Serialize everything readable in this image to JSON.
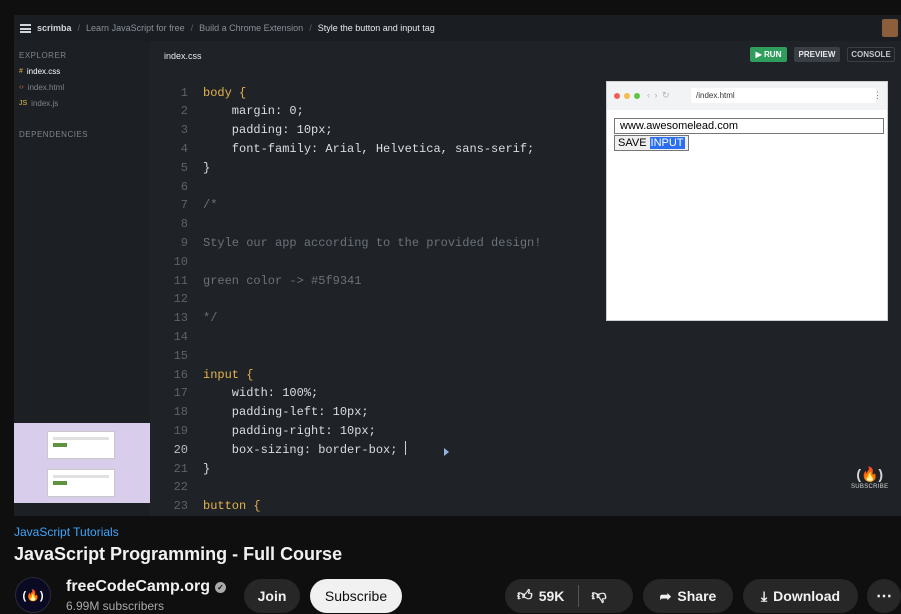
{
  "breadcrumb": {
    "brand": "scrimba",
    "items": [
      "Learn JavaScript for free",
      "Build a Chrome Extension"
    ],
    "active": "Style the button and input tag"
  },
  "sidebar": {
    "explorer_label": "EXPLORER",
    "files": [
      {
        "icon": "#",
        "name": "index.css",
        "active": true
      },
      {
        "icon": "‹›",
        "name": "index.html",
        "active": false
      },
      {
        "icon": "JS",
        "name": "index.js",
        "active": false
      }
    ],
    "dependencies_label": "DEPENDENCIES"
  },
  "editor": {
    "tab": "index.css",
    "run_label": "▶ RUN",
    "preview_label": "PREVIEW",
    "console_label": "CONSOLE",
    "lines": [
      {
        "n": "1",
        "text": "body {"
      },
      {
        "n": "2",
        "text": "    margin: 0;"
      },
      {
        "n": "3",
        "text": "    padding: 10px;"
      },
      {
        "n": "4",
        "text": "    font-family: Arial, Helvetica, sans-serif;"
      },
      {
        "n": "5",
        "text": "}"
      },
      {
        "n": "6",
        "text": ""
      },
      {
        "n": "7",
        "text": "/*"
      },
      {
        "n": "8",
        "text": ""
      },
      {
        "n": "9",
        "text": "Style our app according to the provided design!"
      },
      {
        "n": "10",
        "text": ""
      },
      {
        "n": "11",
        "text": "green color -> #5f9341"
      },
      {
        "n": "12",
        "text": ""
      },
      {
        "n": "13",
        "text": "*/"
      },
      {
        "n": "14",
        "text": ""
      },
      {
        "n": "15",
        "text": ""
      },
      {
        "n": "16",
        "text": "input {"
      },
      {
        "n": "17",
        "text": "    width: 100%;"
      },
      {
        "n": "18",
        "text": "    padding-left: 10px;"
      },
      {
        "n": "19",
        "text": "    padding-right: 10px;"
      },
      {
        "n": "20",
        "text": "    box-sizing: border-box;"
      },
      {
        "n": "21",
        "text": "}"
      },
      {
        "n": "22",
        "text": ""
      },
      {
        "n": "23",
        "text": "button {"
      }
    ]
  },
  "preview": {
    "url": "/index.html",
    "input_value": "www.awesomelead.com",
    "button_text": "SAVE",
    "button_highlight": "INPUT"
  },
  "watermark": {
    "logo": "(🔥)",
    "label": "SUBSCRIBE"
  },
  "video": {
    "playlist": "JavaScript Tutorials",
    "title": "JavaScript Programming - Full Course",
    "channel": "freeCodeCamp.org",
    "channel_avatar": "(🔥)",
    "subscribers": "6.99M subscribers",
    "join_label": "Join",
    "subscribe_label": "Subscribe",
    "likes": "59K",
    "share_label": "Share",
    "download_label": "Download",
    "more_label": "⋯"
  },
  "colors": {
    "run": "#2f9e5d",
    "accent_link": "#3ea6ff",
    "design_green": "#5f9341",
    "thumb_bg": "#d8cdea"
  }
}
